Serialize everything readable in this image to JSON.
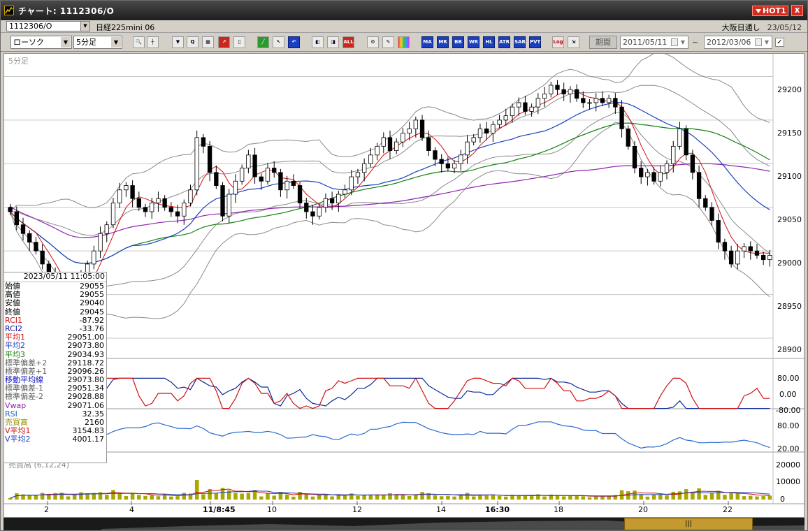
{
  "window": {
    "title": "チャート: 1112306/O",
    "hot_label": "HOT1",
    "close_label": "x"
  },
  "symbol_bar": {
    "code": "1112306/O",
    "name": "日経225mini 06",
    "market": "大阪日通し",
    "date": "23/05/12"
  },
  "toolbar": {
    "chart_type": "ローソク",
    "interval": "5分足",
    "buttons": [
      "zoom",
      "crosshair",
      "indicator",
      "find",
      "grid",
      "draw-trend",
      "eraser",
      "line",
      "cursor",
      "undo",
      "range",
      "fit",
      "ALL",
      "settings",
      "tools",
      "palette",
      "MA",
      "MR",
      "BB",
      "WRE",
      "HL",
      "ATR",
      "PSAR",
      "PVT",
      "Log",
      "export"
    ],
    "period_label": "期間",
    "date_from": "2011/05/11",
    "date_to": "2012/03/06",
    "date_separator": "~"
  },
  "chart": {
    "interval_label": "5分足",
    "y_ticks": [
      "29200",
      "29150",
      "29100",
      "29050",
      "29000",
      "28950",
      "28900"
    ],
    "x_ticks": [
      "2",
      "4",
      "11/8:45",
      "10",
      "12",
      "14",
      "16:30",
      "18",
      "20",
      "22"
    ],
    "osc1_ticks": [
      "80.00",
      "0.00",
      "-80.00"
    ],
    "rsi_ticks": [
      "80.00",
      "20.00"
    ],
    "volume_ticks": [
      "20000",
      "10000",
      "0"
    ],
    "volume_label": "売買高 (6,12,24)"
  },
  "chart_data": {
    "type": "candlestick",
    "series_names": [
      "始値",
      "高値",
      "安値",
      "終値",
      "RCI1",
      "RCI2",
      "平均1",
      "平均2",
      "平均3",
      "標準偏差+2",
      "標準偏差+1",
      "移動平均線",
      "標準偏差-1",
      "標準偏差-2",
      "Vwap",
      "RSI",
      "売買高",
      "V平均1",
      "V平均2"
    ],
    "ylim": [
      28880,
      29210
    ],
    "closes": [
      29045,
      29030,
      29020,
      29010,
      29000,
      28985,
      28975,
      28960,
      28945,
      28940,
      28950,
      28970,
      28985,
      29000,
      29020,
      29030,
      29055,
      29070,
      29075,
      29060,
      29050,
      29045,
      29055,
      29060,
      29050,
      29045,
      29040,
      29055,
      29070,
      29130,
      29120,
      29090,
      29075,
      29040,
      29065,
      29080,
      29095,
      29110,
      29085,
      29080,
      29095,
      29090,
      29070,
      29080,
      29075,
      29055,
      29045,
      29040,
      29050,
      29060,
      29055,
      29065,
      29070,
      29085,
      29090,
      29100,
      29110,
      29120,
      29130,
      29115,
      29125,
      29135,
      29140,
      29150,
      29130,
      29115,
      29105,
      29100,
      29095,
      29100,
      29110,
      29125,
      29130,
      29140,
      29135,
      29145,
      29150,
      29155,
      29165,
      29170,
      29160,
      29165,
      29175,
      29180,
      29190,
      29185,
      29180,
      29185,
      29175,
      29170,
      29170,
      29175,
      29170,
      29175,
      29165,
      29140,
      29120,
      29095,
      29085,
      29090,
      29080,
      29090,
      29100,
      29120,
      29140,
      29110,
      29090,
      29060,
      29050,
      29035,
      29010,
      29000,
      28985,
      29000,
      29005,
      29000,
      28995,
      28990,
      28995
    ],
    "highlighted_bar": {
      "datetime": "2023/05/11 11:05:00",
      "open": 29055,
      "high": 29055,
      "low": 29040,
      "close": 29045
    },
    "info_rows": [
      {
        "label": "始値",
        "value": "29055",
        "color": "#000000"
      },
      {
        "label": "高値",
        "value": "29055",
        "color": "#000000"
      },
      {
        "label": "安値",
        "value": "29040",
        "color": "#000000"
      },
      {
        "label": "終値",
        "value": "29045",
        "color": "#000000"
      },
      {
        "label": "RCI1",
        "value": "-87.92",
        "color": "#d01010"
      },
      {
        "label": "RCI2",
        "value": "-33.76",
        "color": "#1010a0"
      },
      {
        "label": "平均1",
        "value": "29051.00",
        "color": "#d01010"
      },
      {
        "label": "平均2",
        "value": "29073.80",
        "color": "#1a3fbf"
      },
      {
        "label": "平均3",
        "value": "29034.93",
        "color": "#108010"
      },
      {
        "label": "標準偏差+2",
        "value": "29118.72",
        "color": "#606060"
      },
      {
        "label": "標準偏差+1",
        "value": "29096.26",
        "color": "#606060"
      },
      {
        "label": "移動平均線",
        "value": "29073.80",
        "color": "#1010c0"
      },
      {
        "label": "標準偏差-1",
        "value": "29051.34",
        "color": "#606060"
      },
      {
        "label": "標準偏差-2",
        "value": "29028.88",
        "color": "#606060"
      },
      {
        "label": "Vwap",
        "value": "29071.06",
        "color": "#9020b0"
      },
      {
        "label": "RSI",
        "value": "32.35",
        "color": "#2060c8"
      },
      {
        "label": "売買高",
        "value": "2160",
        "color": "#909000"
      },
      {
        "label": "V平均1",
        "value": "3154.83",
        "color": "#d01010"
      },
      {
        "label": "V平均2",
        "value": "4001.17",
        "color": "#1a3fbf"
      }
    ],
    "colors": {
      "up": "#ffffff",
      "down": "#000000",
      "ma1": "#d01010",
      "ma2": "#1a3fbf",
      "ma3": "#108010",
      "bands": "#808080",
      "vwap": "#9020b0",
      "rci1": "#d01010",
      "rci2": "#0a2a9a",
      "rsi": "#2a6ad0",
      "volume": "#a8a800"
    }
  }
}
